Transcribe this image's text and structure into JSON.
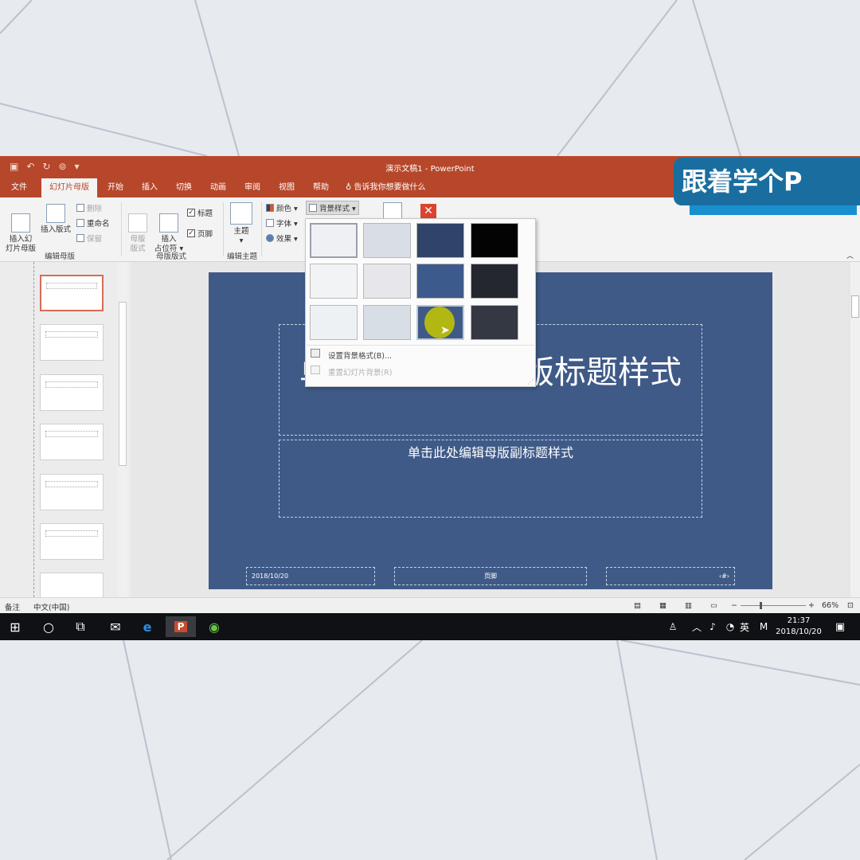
{
  "window": {
    "doc_title": "演示文稿1  -  PowerPoint"
  },
  "tabs": [
    "文件",
    "幻灯片母版",
    "开始",
    "插入",
    "切换",
    "动画",
    "审阅",
    "视图",
    "帮助"
  ],
  "tell_me": "告诉我你想要做什么",
  "ribbon": {
    "insert_master": "插入幻\n灯片母版",
    "insert_layout": "插入版式",
    "delete": "删除",
    "rename": "重命名",
    "preserve": "保留",
    "group_edit_master": "编辑母版",
    "master_layout": "母版\n版式",
    "insert_placeholder": "插入\n占位符 ▾",
    "title_check": "标题",
    "footer_check": "页脚",
    "group_master_layout": "母版版式",
    "theme": "主题",
    "group_edit_theme": "编辑主题",
    "colors": "颜色 ▾",
    "fonts": "字体 ▾",
    "effects": "效果 ▾",
    "bg_styles": "背景样式 ▾"
  },
  "background_menu": {
    "swatches": [
      "#eef0f3",
      "#d9dee6",
      "#2f4468",
      "#030303",
      "#f2f3f5",
      "#e6e6eb",
      "#3d5a8c",
      "#24272e",
      "#eef1f4",
      "#d8dee5",
      "#3f5a87",
      "#333842"
    ],
    "format_background": "设置背景格式(B)...",
    "reset_background": "重置幻灯片背景(R)"
  },
  "slide": {
    "title_text": "单击此处编辑母版标题样式",
    "subtitle_text": "单击此处编辑母版副标题样式",
    "date": "2018/10/20",
    "footer": "页脚",
    "page_number": "‹#›"
  },
  "statusbar": {
    "notes": "备注",
    "language": "中文(中国)",
    "zoom": "66%"
  },
  "taskbar": {
    "ime": "英",
    "time": "21:37",
    "date": "2018/10/20"
  },
  "watermark": "跟着学个P",
  "colors": {
    "accent": "#b7472a",
    "slide_bg": "#3f5a87"
  }
}
